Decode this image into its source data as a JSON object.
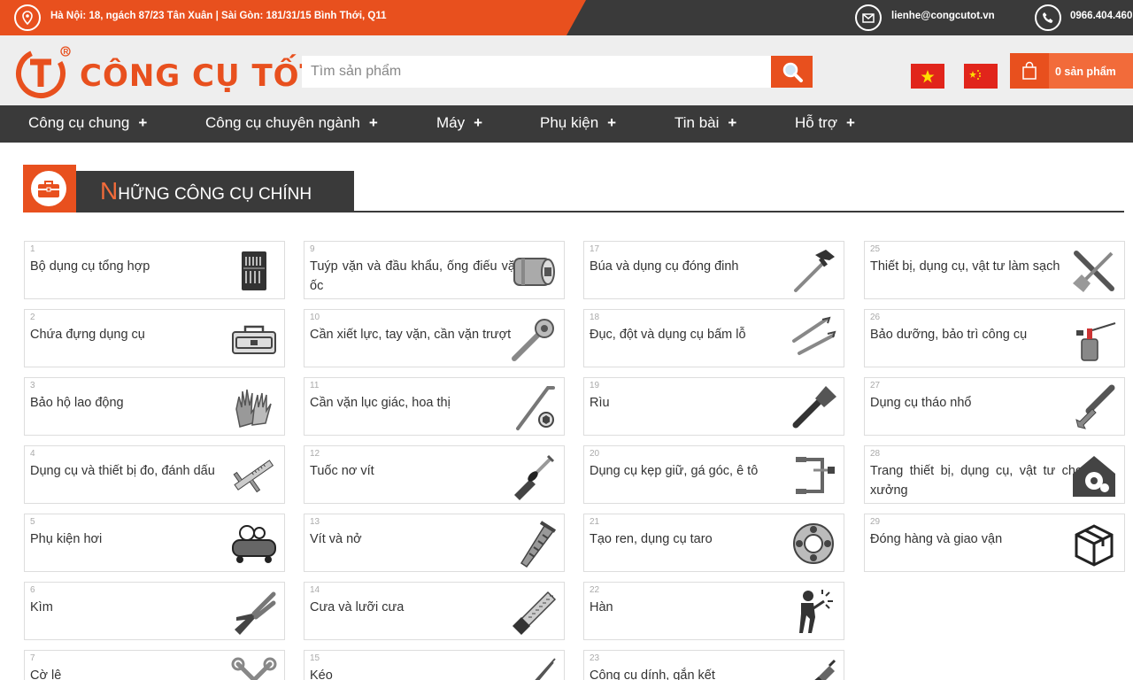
{
  "topbar": {
    "address": "Hà Nội: 18, ngách 87/23 Tân Xuân | Sài Gòn: 181/31/15 Bình Thới, Q11",
    "email": "lienhe@congcutot.vn",
    "phone": "0966.404.460"
  },
  "header": {
    "brand": "CÔNG CỤ TỐT",
    "search_placeholder": "Tìm sản phẩm",
    "cart_label": "0 sản phẩm"
  },
  "nav": [
    "Công cụ chung",
    "Công cụ chuyên ngành",
    "Máy",
    "Phụ kiện",
    "Tin bài",
    "Hỗ trợ"
  ],
  "nav_plus": "+",
  "section": {
    "title_first": "N",
    "title_rest": "HỮNG CÔNG CỤ CHÍNH"
  },
  "categories": [
    {
      "num": "1",
      "label": "Bộ dụng cụ tổng hợp",
      "icon": "toolkit-icon"
    },
    {
      "num": "2",
      "label": "Chứa đựng dụng cụ",
      "icon": "toolbox-icon"
    },
    {
      "num": "3",
      "label": "Bảo hộ lao động",
      "icon": "gloves-icon"
    },
    {
      "num": "4",
      "label": "Dụng cụ và thiết bị đo, đánh dấu",
      "icon": "caliper-icon"
    },
    {
      "num": "5",
      "label": "Phụ kiện hơi",
      "icon": "air-compressor-icon"
    },
    {
      "num": "6",
      "label": "Kìm",
      "icon": "pliers-icon"
    },
    {
      "num": "7",
      "label": "Cờ lê",
      "icon": "wrench-icon"
    },
    {
      "num": "9",
      "label": "Tuýp vặn và đầu khẩu, ống điếu vặn ốc",
      "icon": "socket-icon"
    },
    {
      "num": "10",
      "label": "Cần xiết lực, tay vặn, cần vặn trượt",
      "icon": "ratchet-icon"
    },
    {
      "num": "11",
      "label": "Cần vặn lục giác, hoa thị",
      "icon": "hex-key-icon"
    },
    {
      "num": "12",
      "label": "Tuốc nơ vít",
      "icon": "screwdriver-icon"
    },
    {
      "num": "13",
      "label": "Vít và nở",
      "icon": "screw-icon"
    },
    {
      "num": "14",
      "label": "Cưa và lưỡi cưa",
      "icon": "saw-icon"
    },
    {
      "num": "15",
      "label": "Kéo",
      "icon": "scissors-icon"
    },
    {
      "num": "17",
      "label": "Búa và dụng cụ đóng đinh",
      "icon": "hammer-icon"
    },
    {
      "num": "18",
      "label": "Đục, đột và dụng cụ bấm lỗ",
      "icon": "chisel-icon"
    },
    {
      "num": "19",
      "label": "Rìu",
      "icon": "axe-icon"
    },
    {
      "num": "20",
      "label": "Dụng cụ kẹp giữ, gá góc, ê tô",
      "icon": "clamp-icon"
    },
    {
      "num": "21",
      "label": "Tạo ren, dụng cụ taro",
      "icon": "threading-die-icon"
    },
    {
      "num": "22",
      "label": "Hàn",
      "icon": "welder-icon"
    },
    {
      "num": "23",
      "label": "Công cụ dính, gắn kết",
      "icon": "glue-gun-icon"
    },
    {
      "num": "25",
      "label": "Thiết bị, dụng cụ, vật tư làm sạch",
      "icon": "cleaning-tools-icon"
    },
    {
      "num": "26",
      "label": "Bảo dưỡng, bảo trì công cụ",
      "icon": "oil-can-icon"
    },
    {
      "num": "27",
      "label": "Dụng cụ tháo nhổ",
      "icon": "pry-tool-icon"
    },
    {
      "num": "28",
      "label": "Trang thiết bị, dụng cụ, vật tư cho xưởng",
      "icon": "workshop-icon"
    },
    {
      "num": "29",
      "label": "Đóng hàng và giao vận",
      "icon": "package-icon"
    }
  ],
  "colors": {
    "accent": "#e8501e",
    "dark": "#3a3a3a",
    "header_bg": "#eeeeee"
  }
}
